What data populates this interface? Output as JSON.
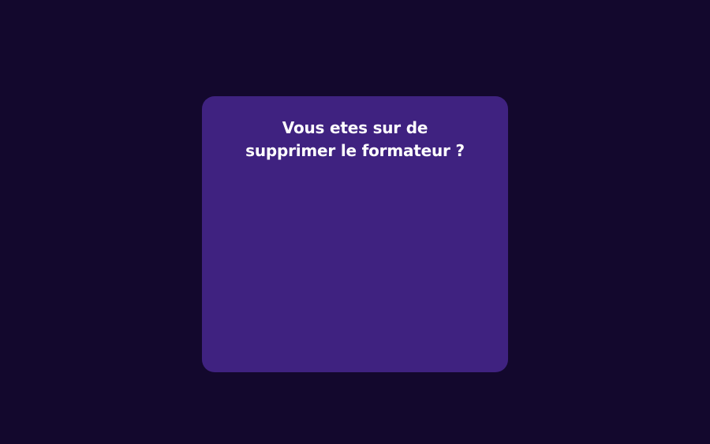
{
  "colors": {
    "backdrop": "#13082d",
    "modal_background": "#3f2280",
    "title_text": "#ffffff"
  },
  "dialog": {
    "title_line_1": "Vous etes sur de",
    "title_line_2": "supprimer le formateur ?"
  }
}
